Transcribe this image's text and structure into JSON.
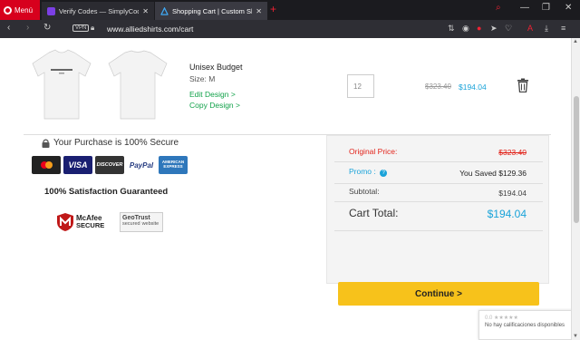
{
  "browser": {
    "menu_label": "Menú",
    "tabs": [
      {
        "title": "Verify Codes — SimplyCodes",
        "active": false
      },
      {
        "title": "Shopping Cart | Custom Shirts",
        "active": true
      }
    ],
    "vpn_label": "VPN",
    "url": "www.alliedshirts.com/cart",
    "accent": "#d7001d"
  },
  "cart_item": {
    "name": "Unisex Budget",
    "size": "Size: M",
    "edit_link": "Edit Design >",
    "copy_link": "Copy Design >",
    "quantity": "12",
    "old_price": "$323.40",
    "new_price": "$194.04"
  },
  "trust": {
    "secure_text": "Your Purchase is 100% Secure",
    "cards": [
      "MasterCard",
      "VISA",
      "DISCOVER",
      "PayPal",
      "AMERICAN EXPRESS"
    ],
    "satisfaction": "100% Satisfaction Guaranteed",
    "mcafee_line1": "McAfee",
    "mcafee_line2": "SECURE",
    "geotrust_line1": "GeoTrust",
    "geotrust_line2": "secured",
    "geotrust_line3": "website"
  },
  "summary": {
    "original_label": "Original Price:",
    "original_value": "$323.40",
    "promo_label": "Promo :",
    "promo_value": "You Saved $129.36",
    "subtotal_label": "Subtotal:",
    "subtotal_value": "$194.04",
    "total_label": "Cart Total:",
    "total_value": "$194.04",
    "continue_label": "Continue >"
  },
  "rating_widget": {
    "score": "0.0",
    "text": "No hay calificaciones disponibles"
  }
}
